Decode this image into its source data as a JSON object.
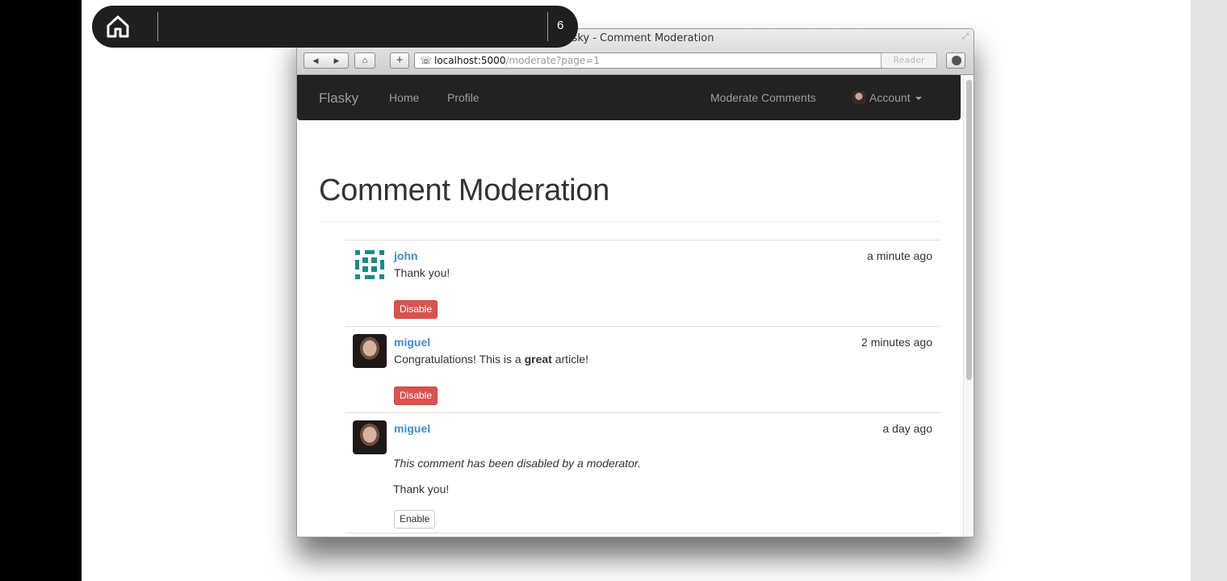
{
  "slide": {
    "page_number": "6"
  },
  "browser": {
    "window_title": "Flasky - Comment Moderation",
    "url_host": "localhost:5000",
    "url_path": "/moderate?page=1",
    "reader_label": "Reader"
  },
  "navbar": {
    "brand": "Flasky",
    "links": [
      "Home",
      "Profile"
    ],
    "moderate": "Moderate Comments",
    "account": "Account"
  },
  "page": {
    "title": "Comment Moderation"
  },
  "comments": [
    {
      "author": "john",
      "time": "a minute ago",
      "body": "Thank you!",
      "button": "Disable"
    },
    {
      "author": "miguel",
      "time": "2 minutes ago",
      "body_before": "Congratulations! This is a ",
      "body_bold": "great",
      "body_after": " article!",
      "button": "Disable"
    },
    {
      "author": "miguel",
      "time": "a day ago",
      "disabled_note": "This comment has been disabled by a moderator.",
      "body": "Thank you!",
      "button": "Enable"
    }
  ],
  "colors": {
    "link": "#428bca",
    "danger": "#d9534f",
    "navbar": "#222222"
  }
}
